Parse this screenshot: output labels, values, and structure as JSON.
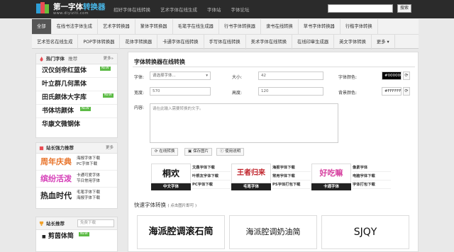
{
  "header": {
    "title_part1": "第一字体",
    "title_part2": "转换器",
    "url": "www.diyiziti.com",
    "top_nav": [
      "招好字体在线转换",
      "艺术字体在线生成",
      "字体站",
      "字体论坛"
    ],
    "search_placeholder": "",
    "search_button": "搜索"
  },
  "nav": {
    "row1": [
      "全部",
      "在线书法字体生成",
      "艺术字转换器",
      "篆体字转换器",
      "毛笔字在线生成器",
      "行书字体转换器",
      "隶书在线转换",
      "草书字体转换器",
      "行楷字体转换"
    ],
    "row2": [
      "艺术签名在线生成",
      "POP字体转换器",
      "花体字转换器",
      "卡通字体在线转换",
      "手写体在线转换",
      "美术字体在线转换",
      "在线印章生成器",
      "英文字体转换",
      "更多"
    ]
  },
  "sidebar": {
    "hot": {
      "title": "热门字体",
      "sub": "推荐",
      "more": "更多»",
      "items": [
        {
          "text": "汉仪剑帝红蓝体",
          "badge": "NEW"
        },
        {
          "text": "叶立群几何黑体",
          "badge": ""
        },
        {
          "text": "田氏颜体大字库",
          "badge": "NEW"
        },
        {
          "text": "书体坊颜体",
          "badge": "NEW"
        },
        {
          "text": "华康文微钢体",
          "badge": ""
        }
      ]
    },
    "rec": {
      "title": "站长强力推荐",
      "more": "更多",
      "items": [
        {
          "art": "周年庆典",
          "links": [
            "海报字体下载",
            "PC字体下载"
          ]
        },
        {
          "art": "缤纷活泼",
          "links": [
            "卡通可爱字体",
            "节日常用字体"
          ]
        },
        {
          "art": "热血时代",
          "links": [
            "毛笔字体下载",
            "海报字体下载"
          ]
        }
      ]
    },
    "owner": {
      "title": "站长推荐",
      "search_placeholder": "免费下载",
      "item": "剪茵体简",
      "badge": "NEW"
    }
  },
  "main": {
    "title": "字体转换器在线转换",
    "labels": {
      "font": "字体:",
      "size": "大小:",
      "color": "字体颜色:",
      "width": "宽度:",
      "height": "高度:",
      "bg": "背景颜色:",
      "content": "内容:"
    },
    "values": {
      "font": "请选择字体...",
      "size": "42",
      "color": "#000000",
      "width": "570",
      "height": "120",
      "bg": "#FFFFFF"
    },
    "content_placeholder": "请在此输入需要转换的文字。",
    "buttons": [
      "在线转换",
      "保存图片",
      "使用说明"
    ],
    "strips": [
      {
        "art": "桐欢",
        "caption": "中文字体",
        "links": [
          "文鼎字体下载",
          "叶根友字体下载",
          "PC字体下载"
        ],
        "cap_color": "#222222"
      },
      {
        "art": "王者归来",
        "caption": "毛笔字体",
        "links": [
          "海报字体下载",
          "常用字体下载",
          "PS字体打包下载"
        ],
        "cap_color": "#222222"
      },
      {
        "art": "好吃嘛",
        "caption": "卡通字体",
        "links": [
          "像素字体",
          "电脑字体下载",
          "字体打包下载"
        ],
        "cap_color": "#222222"
      }
    ],
    "quick_title": "快速字体转换",
    "quick_sub": "( 点击图片即可 )",
    "samples": [
      "海派腔调滚石简",
      "海派腔调奶油简",
      "SJQY"
    ]
  },
  "colors": {
    "header_bg": "#2b2b2b",
    "accent": "#49b7e8",
    "badge": "#5dbb46",
    "active_tab": "#555555"
  }
}
